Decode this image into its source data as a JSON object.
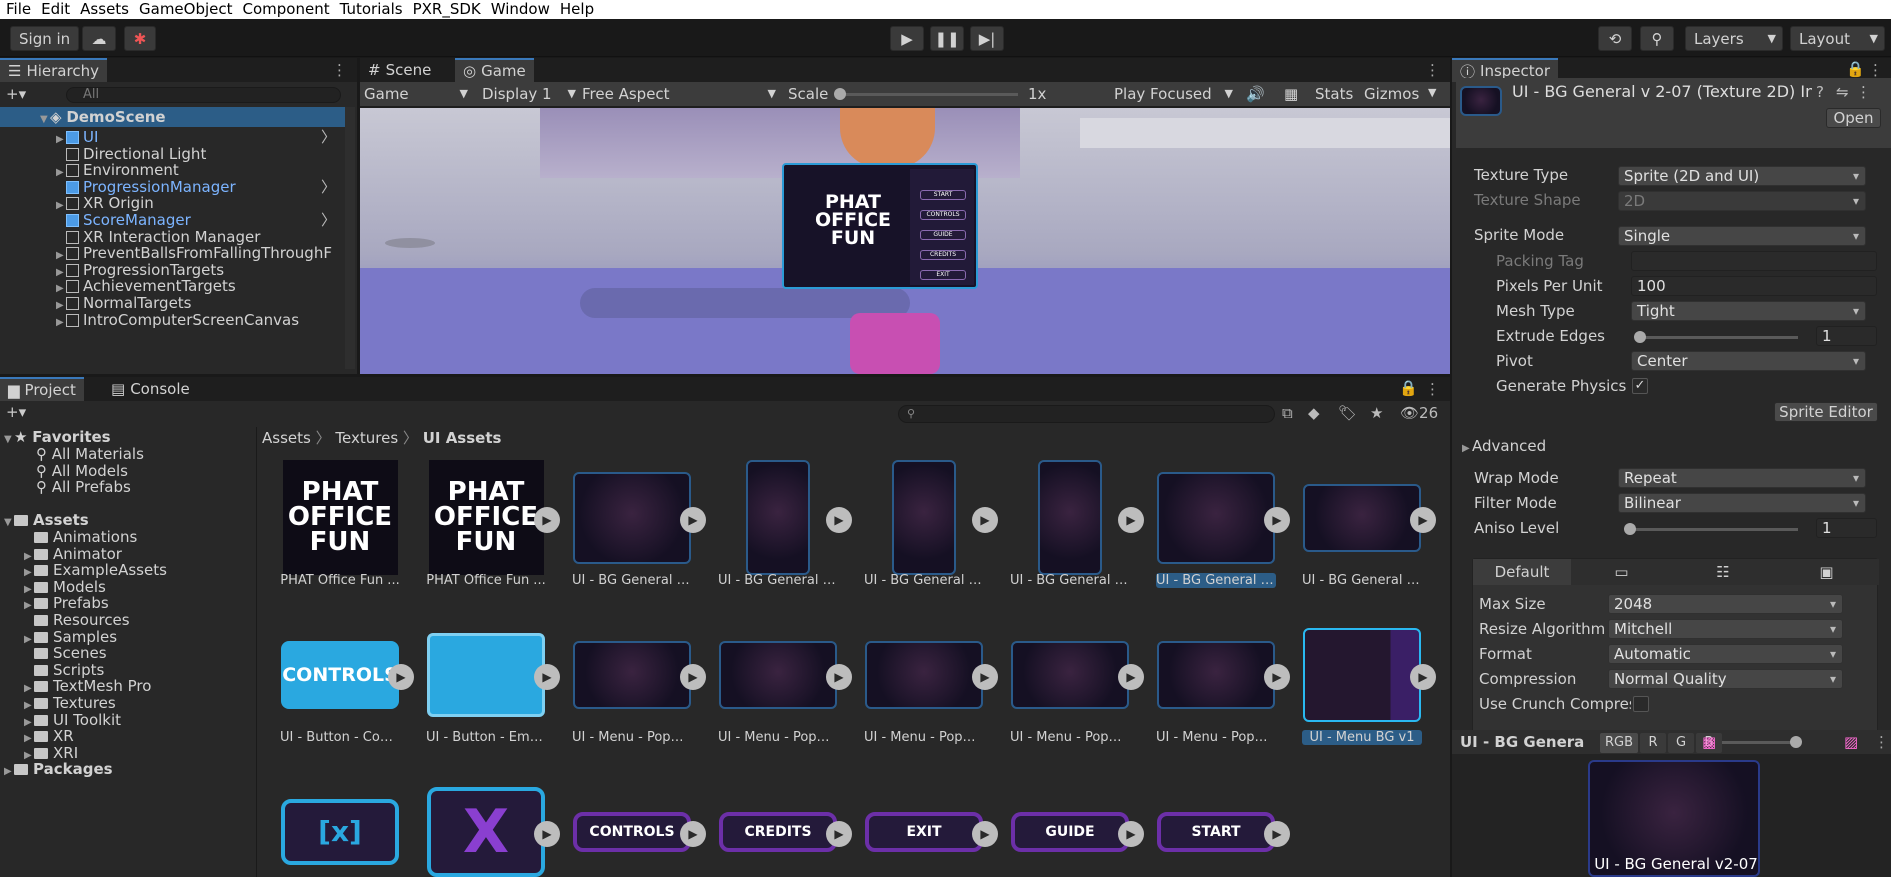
{
  "menubar": [
    "File",
    "Edit",
    "Assets",
    "GameObject",
    "Component",
    "Tutorials",
    "PXR_SDK",
    "Window",
    "Help"
  ],
  "toolbar": {
    "sign_in": "Sign in",
    "layers": "Layers",
    "layout": "Layout"
  },
  "hierarchy": {
    "tab": "Hierarchy",
    "search_placeholder": "All",
    "scene": "DemoScene",
    "items": [
      {
        "label": "UI",
        "blue": true
      },
      {
        "label": "Directional Light",
        "blue": false
      },
      {
        "label": "Environment",
        "blue": false
      },
      {
        "label": "ProgressionManager",
        "blue": true
      },
      {
        "label": "XR Origin",
        "blue": false
      },
      {
        "label": "ScoreManager",
        "blue": true
      },
      {
        "label": "XR Interaction Manager",
        "blue": false
      },
      {
        "label": "PreventBallsFromFallingThroughF",
        "blue": false
      },
      {
        "label": "ProgressionTargets",
        "blue": false
      },
      {
        "label": "AchievementTargets",
        "blue": false
      },
      {
        "label": "NormalTargets",
        "blue": false
      },
      {
        "label": "IntroComputerScreenCanvas",
        "blue": false
      }
    ]
  },
  "gameview": {
    "tab_scene": "Scene",
    "tab_game": "Game",
    "mode": "Game",
    "display": "Display 1",
    "aspect": "Free Aspect",
    "scale_label": "Scale",
    "scale_value": "1x",
    "play": "Play Focused",
    "stats": "Stats",
    "gizmos": "Gizmos",
    "menu_title": "PHAT OFFICE FUN",
    "menu_buttons": [
      "START",
      "CONTROLS",
      "GUIDE",
      "CREDITS",
      "EXIT"
    ]
  },
  "project": {
    "tab_project": "Project",
    "tab_console": "Console",
    "count": "26",
    "favorites_label": "Favorites",
    "favorites": [
      "All Materials",
      "All Models",
      "All Prefabs"
    ],
    "assets_label": "Assets",
    "assets": [
      "Animations",
      "Animator",
      "ExampleAssets",
      "Models",
      "Prefabs",
      "Resources",
      "Samples",
      "Scenes",
      "Scripts",
      "TextMesh Pro",
      "Textures",
      "UI Toolkit",
      "XR",
      "XRI"
    ],
    "packages_label": "Packages",
    "breadcrumb": [
      "Assets",
      "Textures",
      "UI Assets"
    ],
    "row1": [
      "PHAT Office Fun ...",
      "PHAT Office Fun ...",
      "UI - BG General v...",
      "UI - BG General v...",
      "UI - BG General v...",
      "UI - BG General v...",
      "UI - BG General v...",
      "UI - BG General v..."
    ],
    "row2": [
      "UI - Button - Con...",
      "UI - Button - Emai...",
      "UI - Menu - PopU...",
      "UI - Menu - PopU...",
      "UI - Menu - PopU...",
      "UI - Menu - PopU...",
      "UI - Menu - PopU...",
      "UI - Menu BG v1"
    ],
    "row3_text": [
      "[x]",
      "X",
      "CONTROLS",
      "CREDITS",
      "EXIT",
      "GUIDE",
      "START"
    ],
    "controls_text": "CONTROLS"
  },
  "inspector": {
    "tab": "Inspector",
    "title": "UI - BG General v 2-07 (Texture 2D) Imp",
    "open": "Open",
    "texture_type_label": "Texture Type",
    "texture_type": "Sprite (2D and UI)",
    "texture_shape_label": "Texture Shape",
    "texture_shape": "2D",
    "sprite_mode_label": "Sprite Mode",
    "sprite_mode": "Single",
    "packing_tag_label": "Packing Tag",
    "ppu_label": "Pixels Per Unit",
    "ppu": "100",
    "mesh_type_label": "Mesh Type",
    "mesh_type": "Tight",
    "extrude_label": "Extrude Edges",
    "extrude": "1",
    "pivot_label": "Pivot",
    "pivot": "Center",
    "gen_physics_label": "Generate Physics S",
    "sprite_editor": "Sprite Editor",
    "advanced": "Advanced",
    "wrap_label": "Wrap Mode",
    "wrap": "Repeat",
    "filter_label": "Filter Mode",
    "filter": "Bilinear",
    "aniso_label": "Aniso Level",
    "aniso": "1",
    "default_tab": "Default",
    "maxsize_label": "Max Size",
    "maxsize": "2048",
    "resize_label": "Resize Algorithm",
    "resize": "Mitchell",
    "format_label": "Format",
    "format": "Automatic",
    "compression_label": "Compression",
    "compression": "Normal Quality",
    "crunch_label": "Use Crunch Compres",
    "preview_title": "UI - BG Genera",
    "preview_channels": [
      "RGB",
      "R",
      "G",
      "B"
    ],
    "preview_caption": "UI - BG General v2-07"
  }
}
